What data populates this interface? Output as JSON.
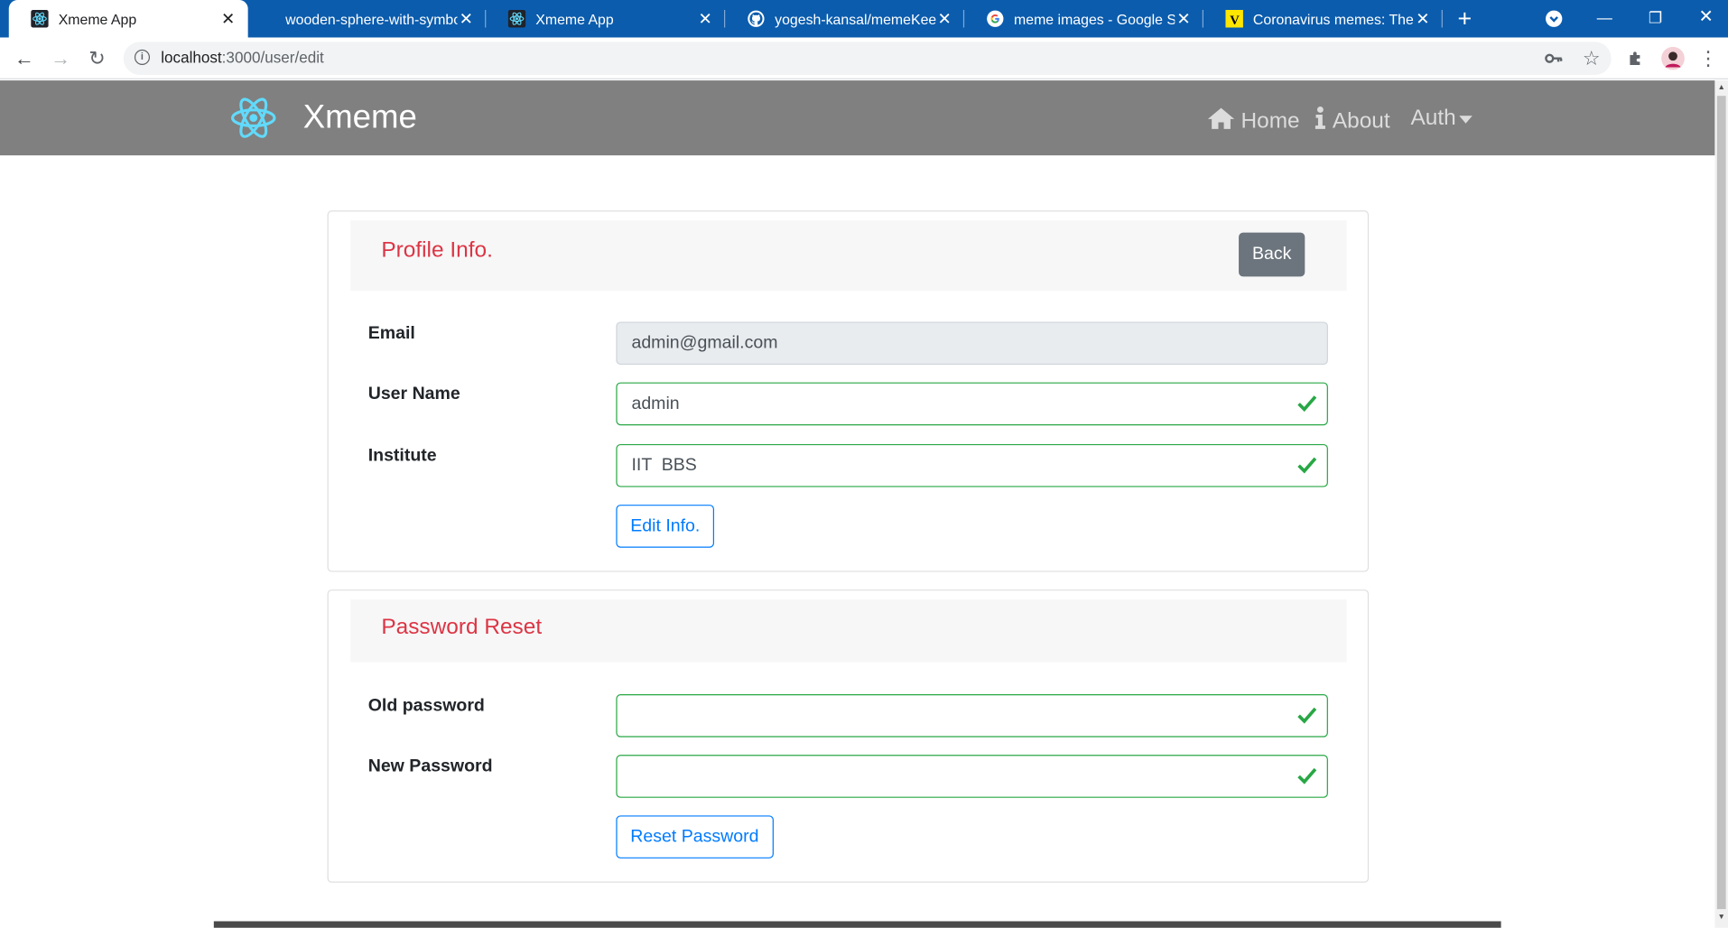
{
  "browser": {
    "tabs": [
      {
        "title": "Xmeme App",
        "active": true,
        "icon": "react-icon"
      },
      {
        "title": "wooden-sphere-with-symbo",
        "active": false,
        "icon": "none"
      },
      {
        "title": "Xmeme App",
        "active": false,
        "icon": "react-icon"
      },
      {
        "title": "yogesh-kansal/memeKeepe",
        "active": false,
        "icon": "github-icon"
      },
      {
        "title": "meme images - Google Sea",
        "active": false,
        "icon": "google-icon"
      },
      {
        "title": "Coronavirus memes: These",
        "active": false,
        "icon": "vice-icon"
      }
    ],
    "url_host": "localhost",
    "url_path": ":3000/user/edit"
  },
  "navbar": {
    "brand": "Xmeme",
    "links": [
      {
        "label": "Home",
        "icon": "home-icon"
      },
      {
        "label": "About",
        "icon": "info-icon"
      },
      {
        "label": "Auth",
        "icon": "caret-down-icon"
      }
    ],
    "color": "#808080"
  },
  "profile": {
    "title": "Profile Info.",
    "back_label": "Back",
    "fields": {
      "email_label": "Email",
      "email_value": "admin@gmail.com",
      "username_label": "User Name",
      "username_value": "admin",
      "institute_label": "Institute",
      "institute_value": "IIT  BBS"
    },
    "edit_label": "Edit Info."
  },
  "password": {
    "title": "Password Reset",
    "old_label": "Old password",
    "old_value": "",
    "new_label": "New Password",
    "new_value": "",
    "reset_label": "Reset Password"
  },
  "colors": {
    "title": "#dc3545",
    "valid": "#28a745",
    "primary": "#007bff",
    "secondary": "#6c757d"
  }
}
